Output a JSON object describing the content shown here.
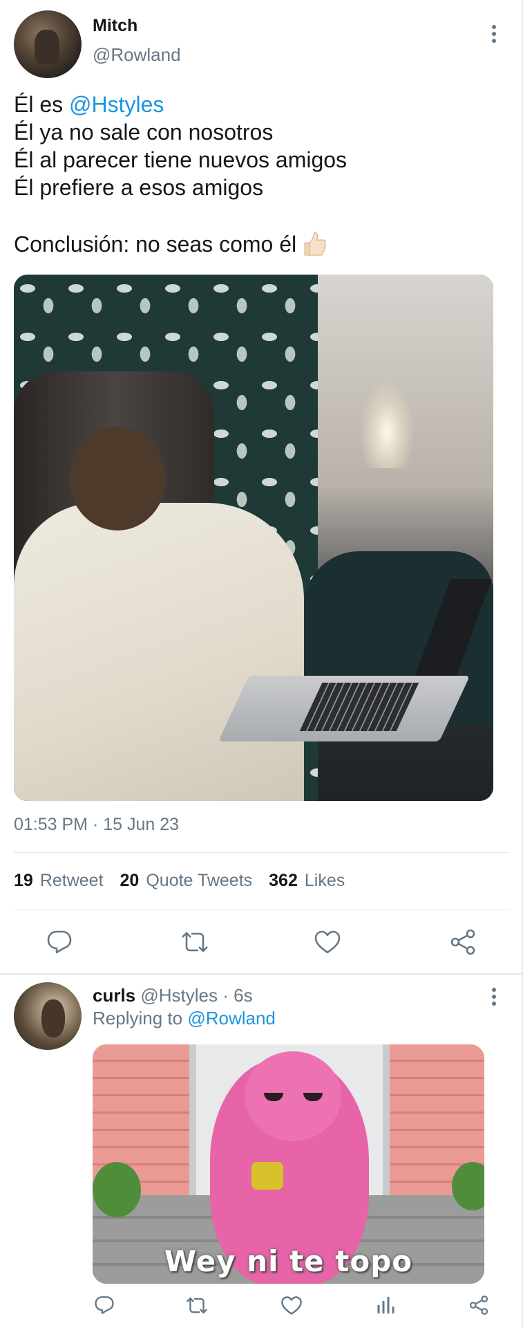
{
  "main_tweet": {
    "display_name": "Mitch",
    "handle": "@Rowland",
    "text_prefix": "Él es ",
    "mention": "@Hstyles",
    "lines": [
      "Él ya no sale con nosotros",
      "Él al parecer tiene nuevos amigos",
      "Él prefiere a esos amigos"
    ],
    "conclusion": "Conclusión: no seas como él",
    "emoji_icon": "thumbs-up",
    "timestamp": "01:53 PM · 15 Jun 23",
    "stats": {
      "retweets_count": "19",
      "retweets_label": "Retweet",
      "quotes_count": "20",
      "quotes_label": "Quote Tweets",
      "likes_count": "362",
      "likes_label": "Likes"
    },
    "actions": [
      "reply-icon",
      "retweet-icon",
      "like-icon",
      "share-icon"
    ]
  },
  "reply_tweet": {
    "display_name": "curls",
    "handle_time": "@Hstyles · 6s",
    "replying_prefix": "Replying to ",
    "replying_to": "@Rowland",
    "image_caption": "Wey ni te topo",
    "actions": [
      "reply-icon",
      "retweet-icon",
      "like-icon",
      "analytics-icon",
      "share-icon"
    ]
  },
  "colors": {
    "link": "#1b95e0",
    "secondary_text": "#657786",
    "divider": "#e1e8ed"
  }
}
